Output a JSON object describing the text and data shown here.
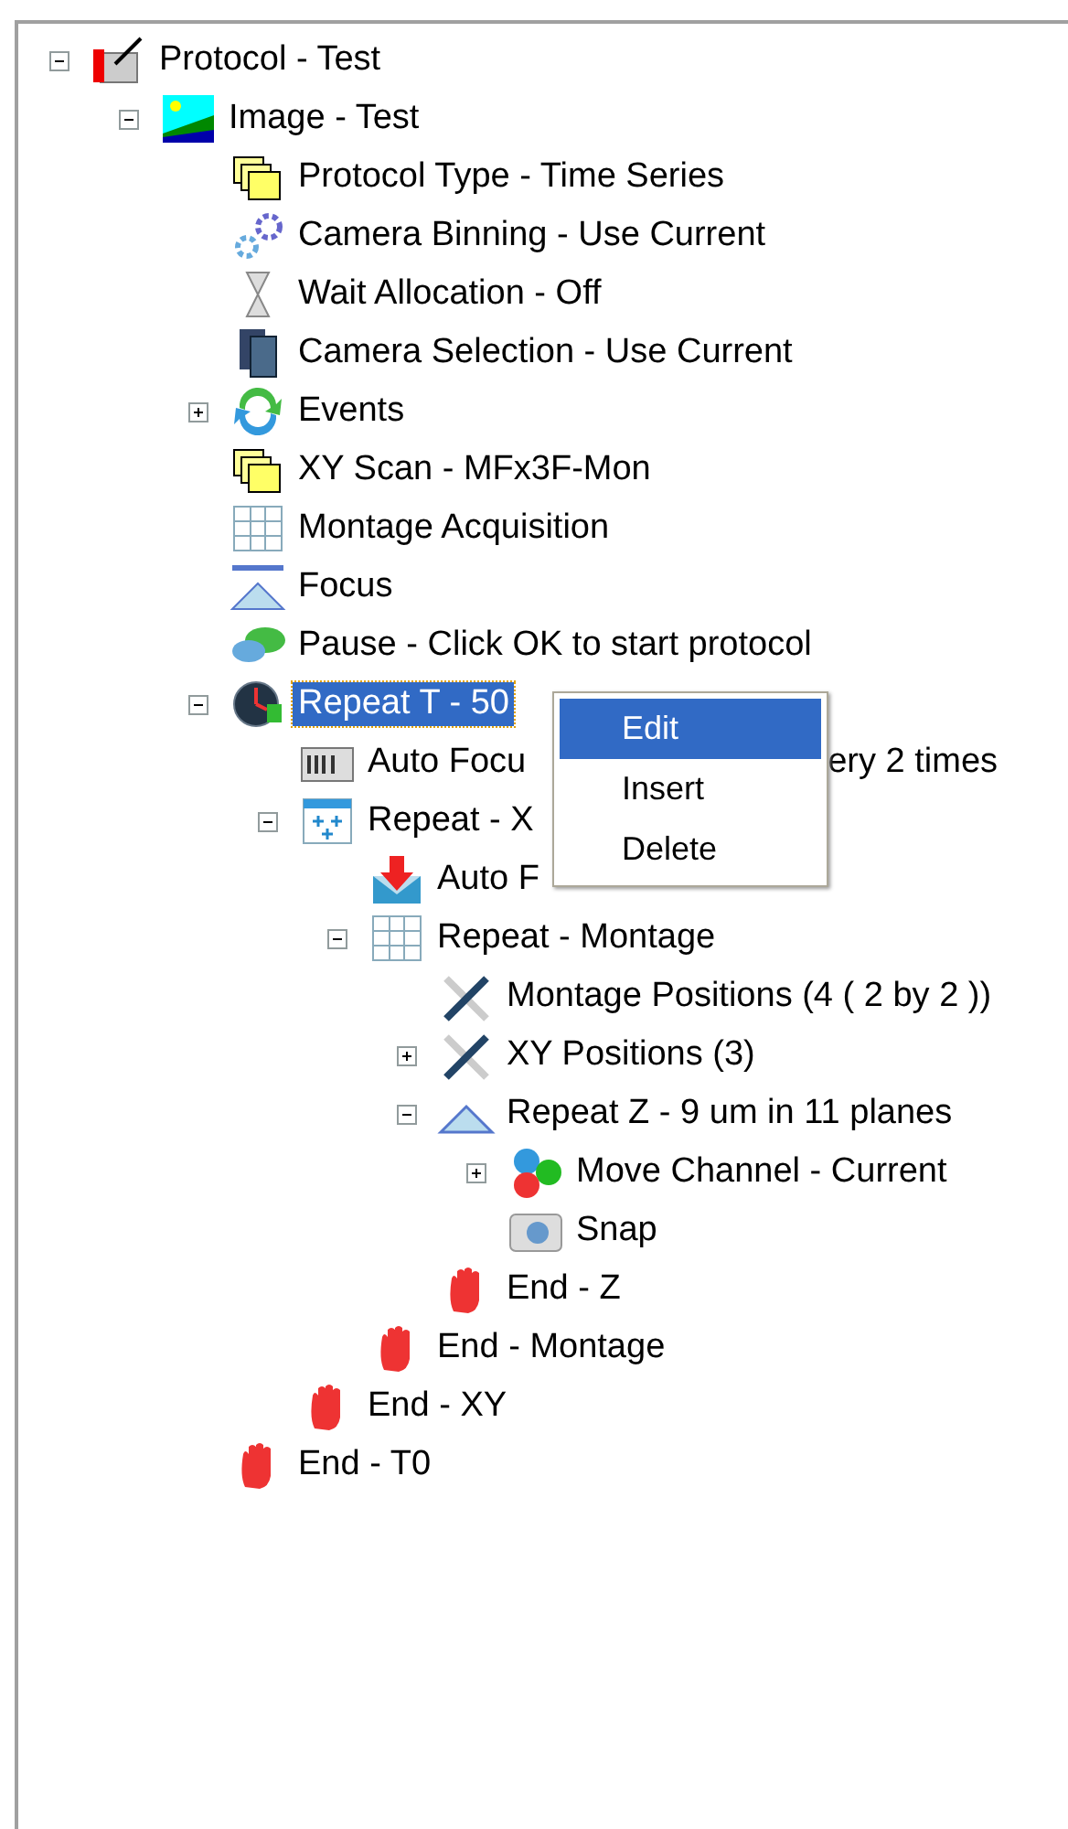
{
  "tree": [
    {
      "label": "Protocol - Test",
      "kind": "protocol",
      "expanded": true,
      "selected": false,
      "children": [
        {
          "label": "Image - Test",
          "kind": "image",
          "expanded": true,
          "selected": false,
          "children": [
            {
              "label": "Protocol Type - Time Series",
              "kind": "folders",
              "selected": false
            },
            {
              "label": "Camera Binning - Use Current",
              "kind": "gears",
              "selected": false
            },
            {
              "label": "Wait Allocation - Off",
              "kind": "hourglass",
              "selected": false
            },
            {
              "label": "Camera Selection - Use Current",
              "kind": "film",
              "selected": false
            },
            {
              "label": "Events",
              "kind": "events",
              "expanded": false,
              "selected": false
            },
            {
              "label": "XY Scan - MFx3F-Mon",
              "kind": "folders",
              "selected": false
            },
            {
              "label": "Montage Acquisition",
              "kind": "grid",
              "selected": false
            },
            {
              "label": "Focus",
              "kind": "focus",
              "selected": false
            },
            {
              "label": "Pause - Click OK to start protocol",
              "kind": "pause",
              "selected": false
            },
            {
              "label": "Repeat T - 50",
              "kind": "clock",
              "expanded": true,
              "selected": true,
              "children": [
                {
                  "label": "Auto Focu",
                  "tail": "ery 2 times",
                  "kind": "counter",
                  "selected": false
                },
                {
                  "label": "Repeat - X",
                  "kind": "gridplus",
                  "expanded": true,
                  "selected": false,
                  "children": [
                    {
                      "label": "Auto F",
                      "kind": "autofocus",
                      "selected": false
                    },
                    {
                      "label": "Repeat - Montage",
                      "kind": "grid",
                      "expanded": true,
                      "selected": false,
                      "children": [
                        {
                          "label": "Montage Positions (4 ( 2 by 2 ))",
                          "kind": "tools",
                          "selected": false
                        },
                        {
                          "label": "XY Positions (3)",
                          "kind": "tools",
                          "expanded": false,
                          "selected": false
                        },
                        {
                          "label": "Repeat Z - 9 um in 11 planes",
                          "kind": "triangle",
                          "expanded": true,
                          "selected": false,
                          "children": [
                            {
                              "label": "Move Channel - Current",
                              "kind": "channels",
                              "expanded": false,
                              "selected": false
                            },
                            {
                              "label": "Snap",
                              "kind": "camera",
                              "selected": false
                            }
                          ]
                        },
                        {
                          "label": "End - Z",
                          "kind": "stop",
                          "selected": false
                        }
                      ]
                    },
                    {
                      "label": "End - Montage",
                      "kind": "stop",
                      "selected": false
                    }
                  ]
                },
                {
                  "label": "End - XY",
                  "kind": "stop",
                  "selected": false
                }
              ]
            },
            {
              "label": "End - T0",
              "kind": "stop",
              "selected": false
            }
          ]
        }
      ]
    }
  ],
  "context_menu": [
    {
      "label": "Edit",
      "selected": true
    },
    {
      "label": "Insert",
      "selected": false
    },
    {
      "label": "Delete",
      "selected": false
    }
  ]
}
